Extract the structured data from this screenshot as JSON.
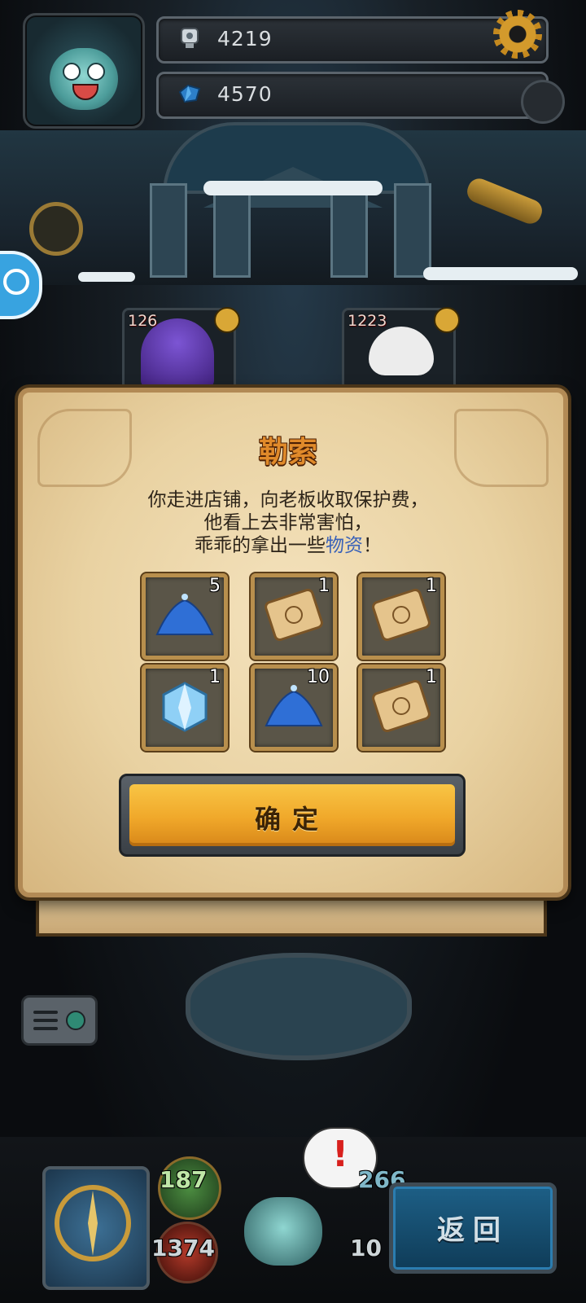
{
  "hud": {
    "currency_1": {
      "icon": "trophy-cup-icon",
      "value": "4219"
    },
    "currency_2": {
      "icon": "blue-crystal-icon",
      "value": "4570"
    }
  },
  "units": [
    {
      "value": "126"
    },
    {
      "value": "1223"
    }
  ],
  "dialog": {
    "title": "勒索",
    "message_line_1": "你走进店铺，向老板收取保护费，",
    "message_line_2": "他看上去非常害怕，",
    "message_line_3_prefix": "乖乖的拿出一些",
    "message_line_3_highlight": "物资",
    "message_line_3_suffix": "！",
    "rewards": [
      {
        "icon": "blue-dust-icon",
        "quantity": "5"
      },
      {
        "icon": "scroll-map-icon",
        "quantity": "1"
      },
      {
        "icon": "scroll-map-icon",
        "quantity": "1"
      },
      {
        "icon": "ice-crystal-icon",
        "quantity": "1"
      },
      {
        "icon": "blue-dust-icon",
        "quantity": "10"
      },
      {
        "icon": "scroll-map-icon",
        "quantity": "1"
      }
    ],
    "confirm_label": "确定"
  },
  "bottom": {
    "stat_green": "187",
    "stat_red": "1374",
    "stat_right_top": "266",
    "stat_right_bottom": "10",
    "alert_mark": "!",
    "back_label": "返回"
  },
  "colors": {
    "title_orange": "#e08a2a",
    "highlight_blue": "#3a62b8",
    "confirm_gold": "#f0a82a",
    "back_blue": "#1d5f86"
  }
}
